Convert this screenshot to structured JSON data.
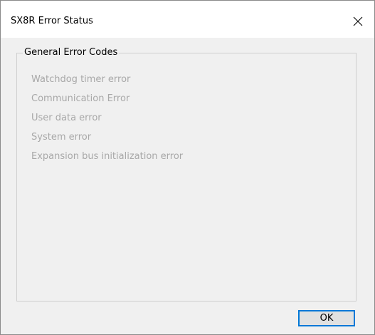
{
  "window": {
    "title": "SX8R Error Status"
  },
  "title_bar": {
    "close_icon": "close-icon"
  },
  "group": {
    "legend": "General Error Codes",
    "items": [
      {
        "label": "Watchdog timer error",
        "active": false
      },
      {
        "label": "Communication Error",
        "active": false
      },
      {
        "label": "User data error",
        "active": false
      },
      {
        "label": "System error",
        "active": false
      },
      {
        "label": "Expansion bus initialization error",
        "active": false
      }
    ]
  },
  "footer": {
    "ok_label": "OK"
  },
  "colors": {
    "inactive_text": "#a8a8a8",
    "focus_border": "#0078d7",
    "dialog_background": "#f0f0f0"
  }
}
